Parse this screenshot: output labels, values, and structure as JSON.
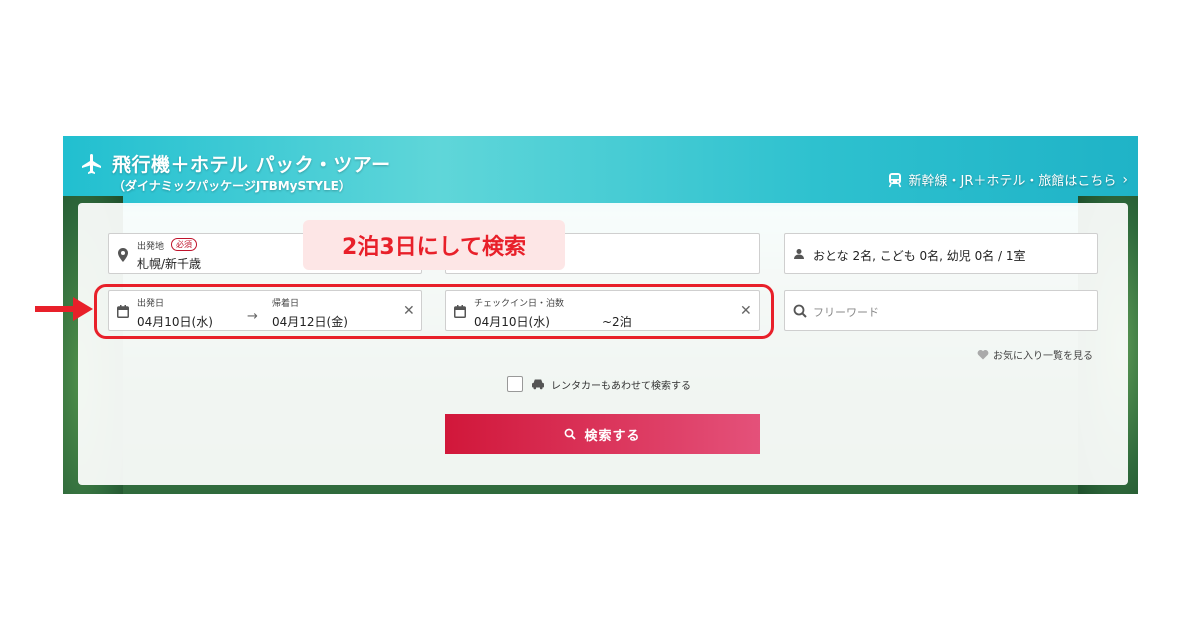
{
  "header": {
    "title": "飛行機＋ホテル パック・ツアー",
    "subtitle": "（ダイナミックパッケージJTBMySTYLE）",
    "rail_link": "新幹線・JR＋ホテル・旅館はこちら"
  },
  "form": {
    "departure": {
      "label": "出発地",
      "required_badge": "必須",
      "value": "札幌/新千歳"
    },
    "travelers": {
      "value": "おとな 2名, こども 0名, 幼児 0名 / 1室"
    },
    "dates": {
      "depart_label": "出発日",
      "depart_value": "04月10日(水)",
      "return_label": "帰着日",
      "return_value": "04月12日(金)"
    },
    "checkin": {
      "label": "チェックイン日・泊数",
      "date_value": "04月10日(水)",
      "nights_value": "~2泊"
    },
    "freeword": {
      "placeholder": "フリーワード"
    },
    "favorites_link": "お気に入り一覧を見る",
    "rental_car_label": "レンタカーもあわせて検索する",
    "search_button": "検索する"
  },
  "annotation": {
    "callout_text": "2泊3日にして検索"
  },
  "colors": {
    "accent_red": "#e8202a",
    "button_start": "#d1173a",
    "button_end": "#e4517a"
  }
}
